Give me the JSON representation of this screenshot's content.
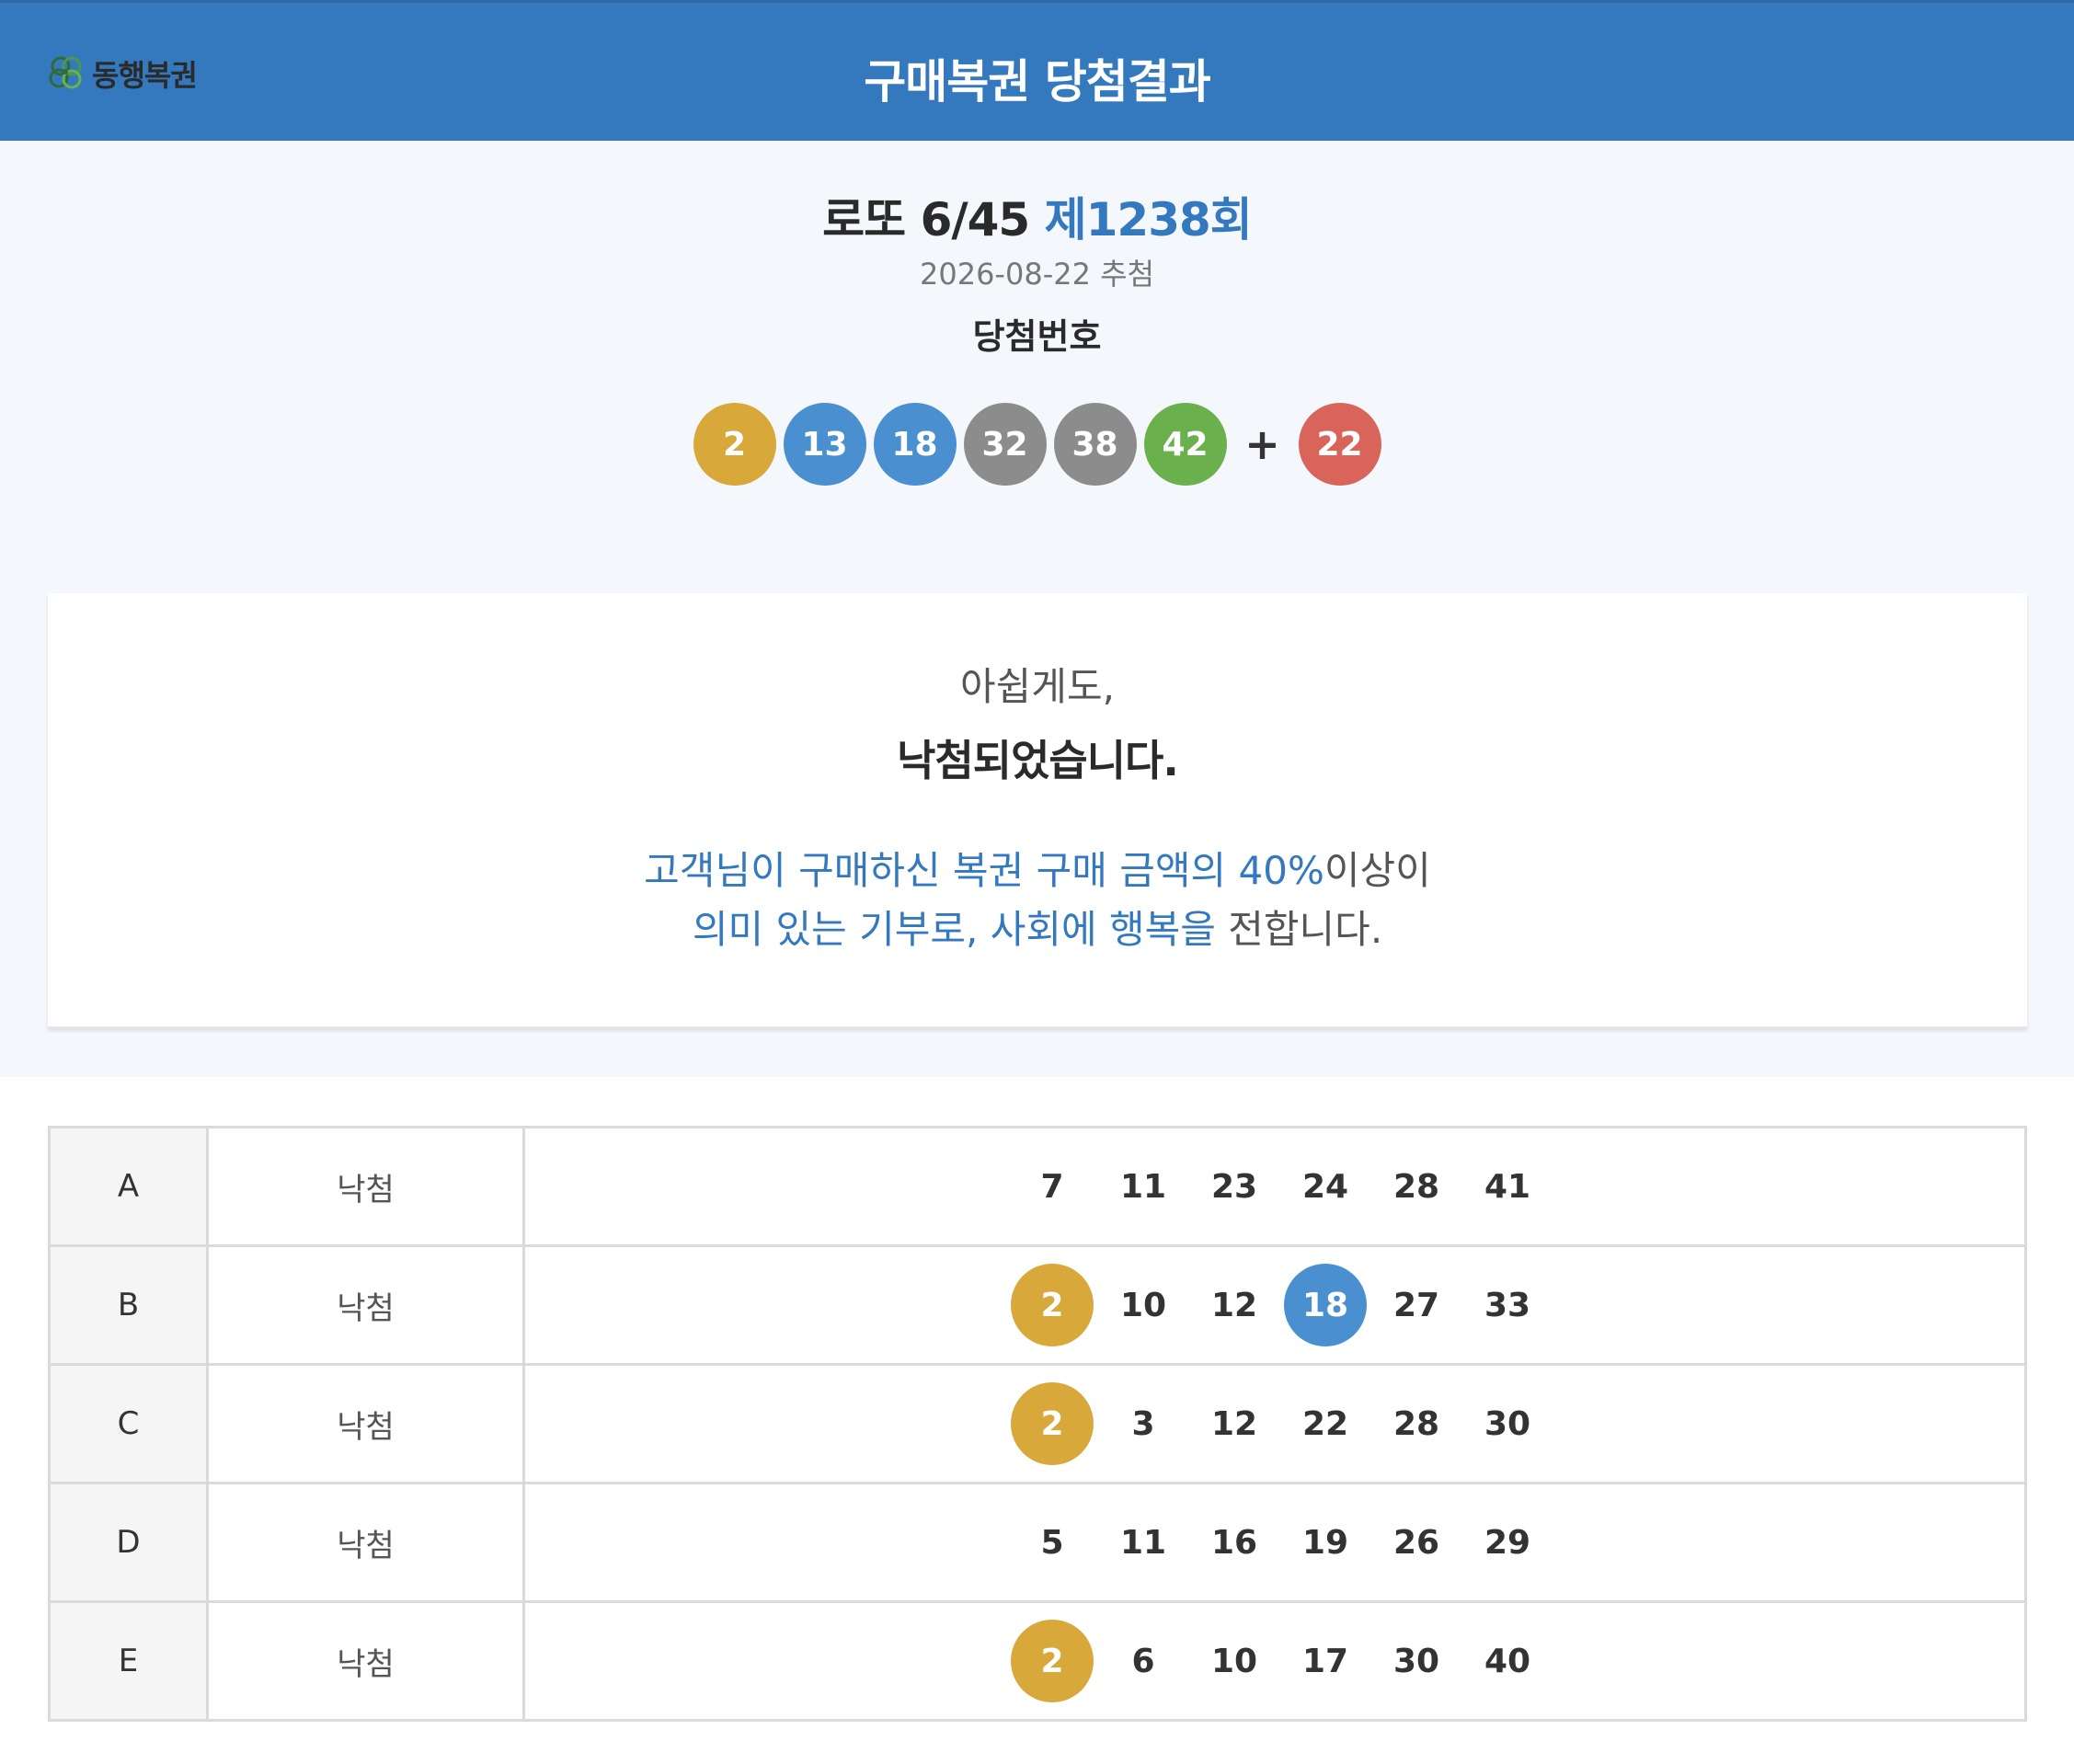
{
  "header": {
    "logo_text": "동행복권",
    "title": "구매복권 당첨결과"
  },
  "summary": {
    "game_name": "로또 6/45",
    "round_label": "제1238회",
    "draw_date": "2026-08-22 추첨",
    "winning_label": "당첨번호",
    "winning_numbers": [
      "2",
      "13",
      "18",
      "32",
      "38",
      "42"
    ],
    "plus_symbol": "+",
    "bonus_number": "22",
    "ball_colors": {
      "yellow": "#d9a83a",
      "blue": "#4a8fd0",
      "gray": "#8c8c8c",
      "green": "#6ab04c",
      "red": "#d9655a"
    }
  },
  "result": {
    "line1": "아쉽게도,",
    "line2": "낙첨되었습니다.",
    "msg1_blue": "고객님이 구매하신 복권 구매 금액의 40%",
    "msg1_plain": "이상이",
    "msg2_blue": "의미 있는 기부로, 사회에 행복을",
    "msg2_plain": " 전합니다."
  },
  "tickets": [
    {
      "label": "A",
      "result": "낙첨",
      "numbers": [
        {
          "n": "7"
        },
        {
          "n": "11"
        },
        {
          "n": "23"
        },
        {
          "n": "24"
        },
        {
          "n": "28"
        },
        {
          "n": "41"
        }
      ]
    },
    {
      "label": "B",
      "result": "낙첨",
      "numbers": [
        {
          "n": "2",
          "hit": "#d9a83a"
        },
        {
          "n": "10"
        },
        {
          "n": "12"
        },
        {
          "n": "18",
          "hit": "#4a8fd0"
        },
        {
          "n": "27"
        },
        {
          "n": "33"
        }
      ]
    },
    {
      "label": "C",
      "result": "낙첨",
      "numbers": [
        {
          "n": "2",
          "hit": "#d9a83a"
        },
        {
          "n": "3"
        },
        {
          "n": "12"
        },
        {
          "n": "22"
        },
        {
          "n": "28"
        },
        {
          "n": "30"
        }
      ]
    },
    {
      "label": "D",
      "result": "낙첨",
      "numbers": [
        {
          "n": "5"
        },
        {
          "n": "11"
        },
        {
          "n": "16"
        },
        {
          "n": "19"
        },
        {
          "n": "26"
        },
        {
          "n": "29"
        }
      ]
    },
    {
      "label": "E",
      "result": "낙첨",
      "numbers": [
        {
          "n": "2",
          "hit": "#d9a83a"
        },
        {
          "n": "6"
        },
        {
          "n": "10"
        },
        {
          "n": "17"
        },
        {
          "n": "30"
        },
        {
          "n": "40"
        }
      ]
    }
  ]
}
